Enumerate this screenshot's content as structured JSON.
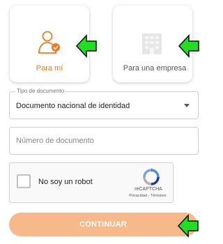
{
  "account_type": {
    "person": {
      "label": "Para mí",
      "icon": "person-icon",
      "selected": true
    },
    "company": {
      "label": "Para una empresa",
      "icon": "building-icon",
      "selected": false
    }
  },
  "document_type": {
    "legend": "Tipo de documento",
    "value": "Documento nacional de identidad"
  },
  "document_number": {
    "placeholder": "Número de documento",
    "value": ""
  },
  "captcha": {
    "label": "No soy un robot",
    "brand": "reCAPTCHA",
    "links": "Privacidad - Términos"
  },
  "submit": {
    "label": "CONTINUAR"
  },
  "colors": {
    "accent": "#f27a1a",
    "button_bg": "#f8b98a",
    "annotation_arrow": "#22dd22"
  }
}
